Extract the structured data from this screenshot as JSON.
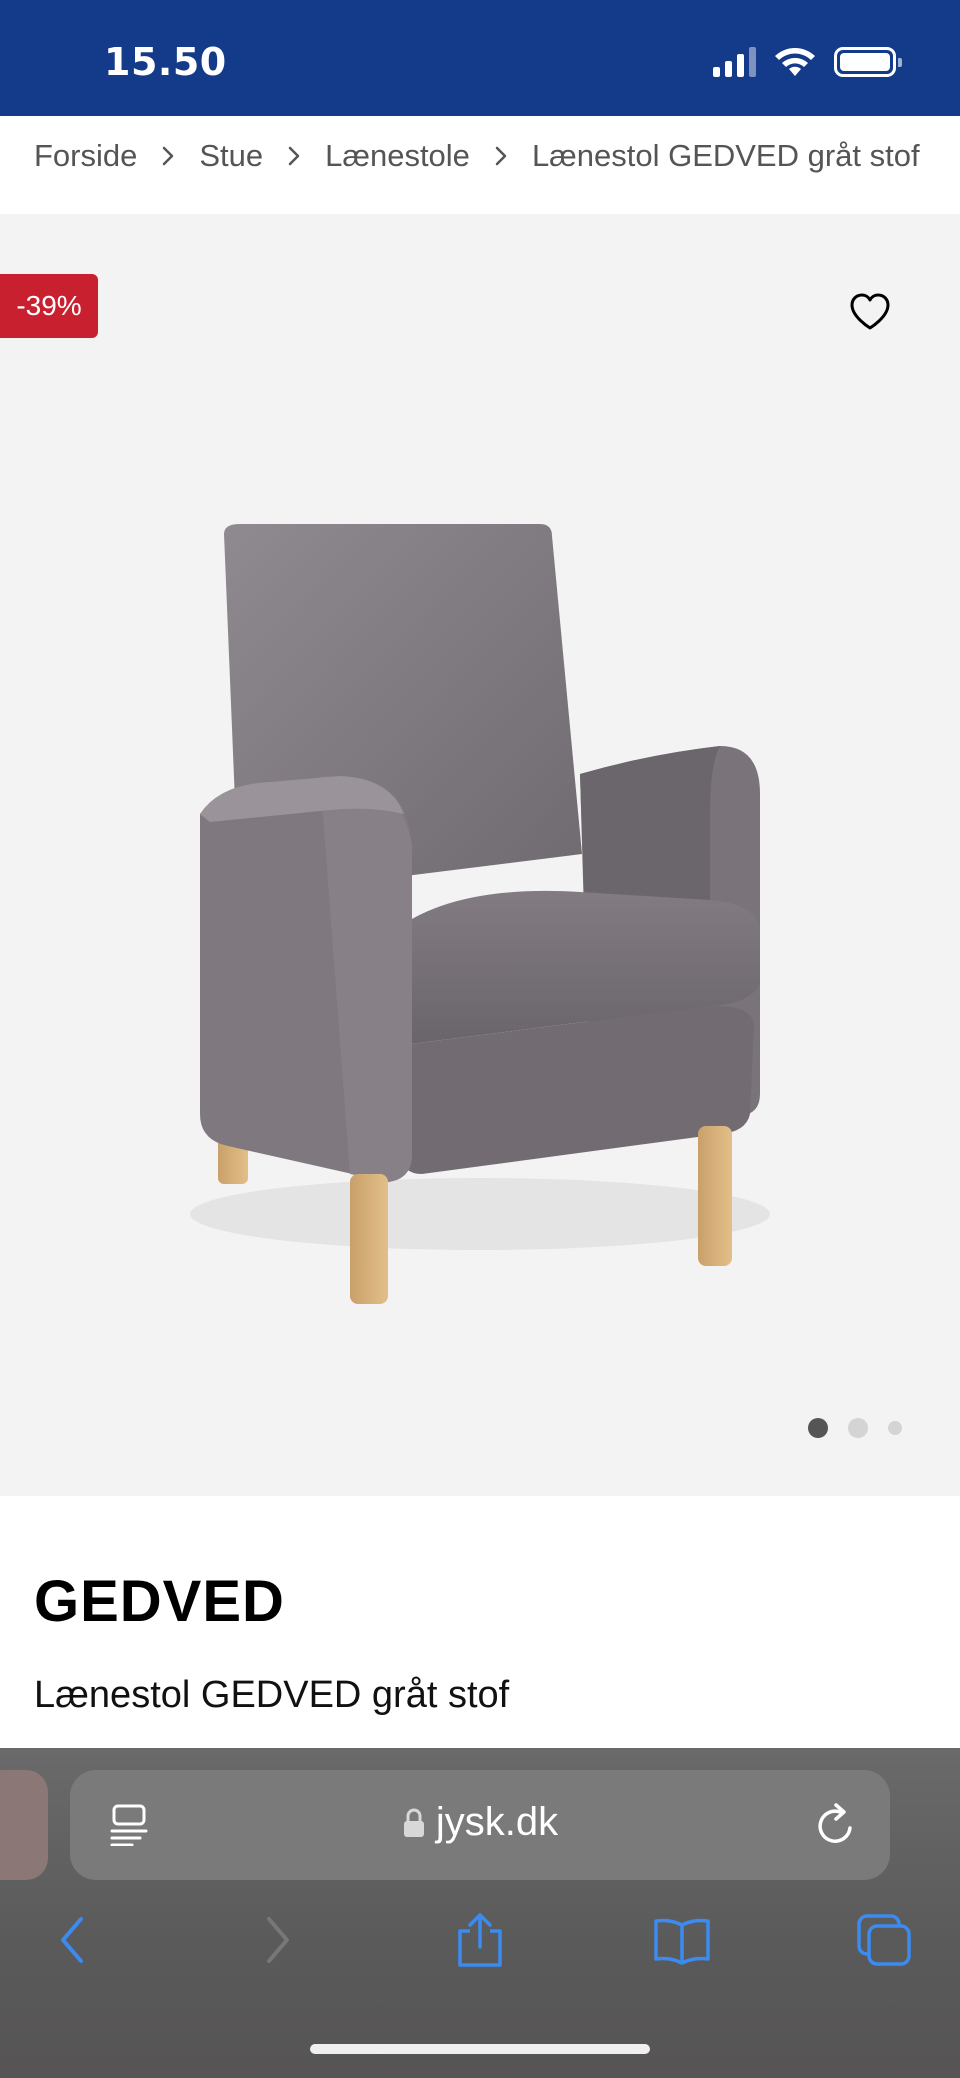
{
  "status_bar": {
    "time": "15.50",
    "background": "#143a8a"
  },
  "breadcrumb": {
    "items": [
      "Forside",
      "Stue",
      "Lænestole",
      "Lænestol GEDVED gråt stof"
    ],
    "separator_icon": "chevron-right-icon"
  },
  "gallery": {
    "discount_badge": "-39%",
    "badge_color": "#c8202f",
    "wishlist_icon": "heart-outline-icon",
    "image": "grey fabric armchair with wooden legs",
    "slides_total": 3,
    "active_slide": 1
  },
  "product": {
    "name": "GEDVED",
    "description": "Lænestol GEDVED gråt stof"
  },
  "browser": {
    "url": "jysk.dk",
    "lock_icon": "lock-icon",
    "reader_icon": "reader-mode-icon",
    "reload_icon": "reload-icon",
    "toolbar": [
      "back-icon",
      "forward-icon",
      "share-icon",
      "bookmarks-icon",
      "tabs-icon"
    ],
    "accent": "#3b8bf0"
  }
}
